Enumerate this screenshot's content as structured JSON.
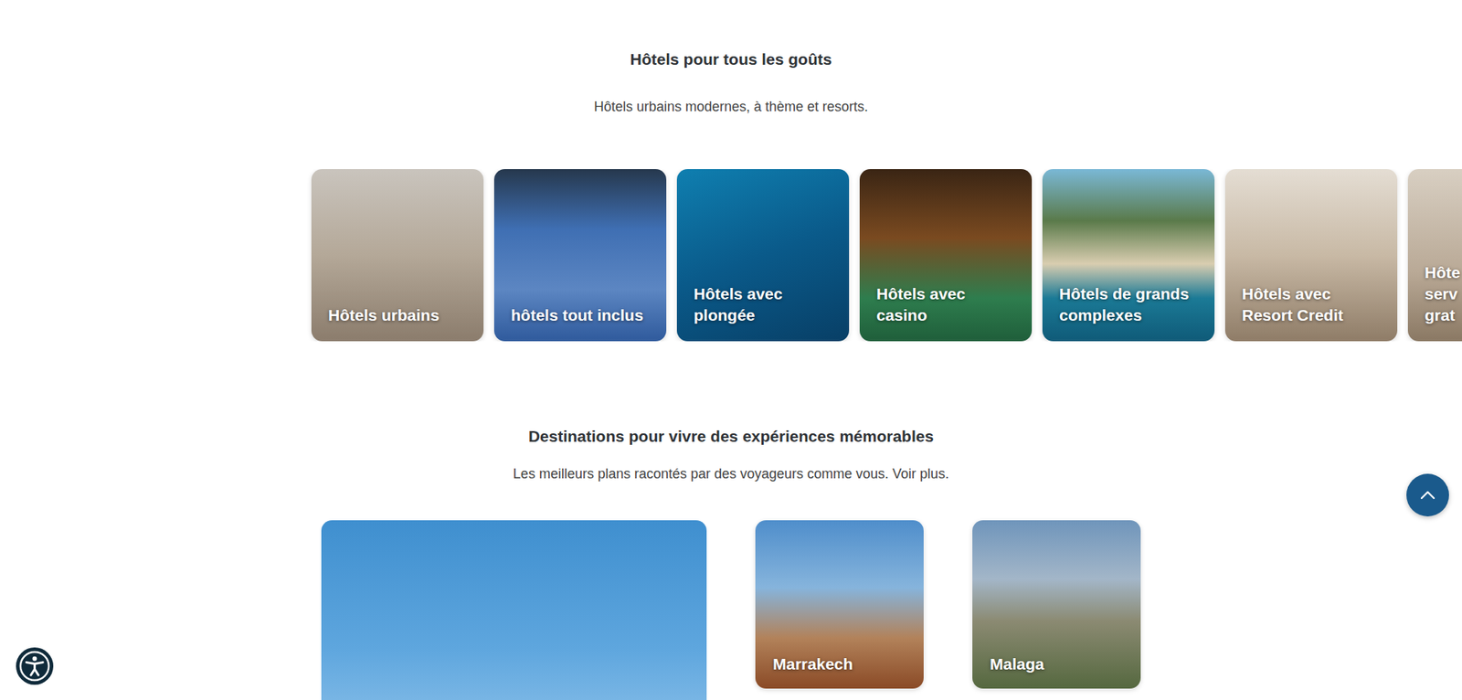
{
  "hotel_types": {
    "title": "Hôtels pour tous les goûts",
    "subtitle": "Hôtels urbains modernes, à thème et resorts.",
    "cards": [
      {
        "label": "Hôtels urbains",
        "kind": "full"
      },
      {
        "label": "hôtels tout inclus",
        "kind": "full"
      },
      {
        "label": "Hôtels avec plongée",
        "kind": "full"
      },
      {
        "label": "Hôtels avec casino",
        "kind": "full"
      },
      {
        "label": "Hôtels de grands complexes",
        "kind": "full"
      },
      {
        "label": "Hôtels avec Resort Credit",
        "kind": "full"
      },
      {
        "label": "Hôte serv grat",
        "kind": "clipped"
      }
    ]
  },
  "destinations": {
    "title": "Destinations pour vivre des expériences mémorables",
    "subtitle": "Les meilleurs plans racontés par des voyageurs comme vous. Voir plus.",
    "cards": [
      {
        "label": "Marrakech"
      },
      {
        "label": "Malaga"
      }
    ]
  }
}
